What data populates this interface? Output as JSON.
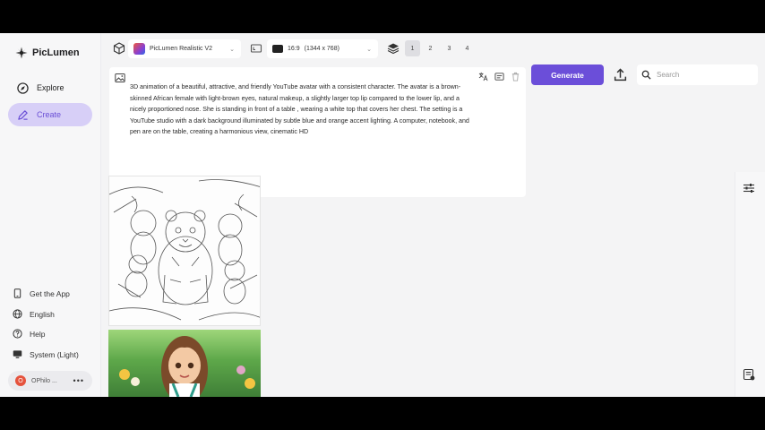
{
  "app": {
    "name": "PicLumen"
  },
  "nav": [
    {
      "label": "Explore",
      "icon": "compass-icon"
    },
    {
      "label": "Create",
      "icon": "pen-icon",
      "active": true
    }
  ],
  "bottom_nav": [
    {
      "label": "Get the App",
      "icon": "phone-icon"
    },
    {
      "label": "English",
      "icon": "globe-icon"
    },
    {
      "label": "Help",
      "icon": "help-icon"
    },
    {
      "label": "System (Light)",
      "icon": "monitor-icon"
    }
  ],
  "user": {
    "initial": "O",
    "name": "OPhilo ..."
  },
  "toolbar": {
    "model": "PicLumen Realistic V2",
    "ratio": "16:9",
    "resolution": "(1344 x 768)",
    "counts": [
      "1",
      "2",
      "3",
      "4"
    ],
    "selected_count": "1"
  },
  "prompt": {
    "text": "3D animation of a beautiful, attractive, and friendly YouTube avatar with a consistent character. The avatar is a brown-skinned African female with light-brown eyes, natural makeup, a slightly larger top lip compared to the lower lip, and a nicely proportioned nose. She is standing in front of a table , wearing a white top that covers her chest. The setting is a YouTube studio with a dark background illuminated by subtle blue and orange accent lighting. A computer, notebook, and pen are on the table, creating a harmonious view, cinematic HD"
  },
  "actions": {
    "generate": "Generate",
    "search_placeholder": "Search"
  },
  "colors": {
    "accent": "#6b4ed9",
    "active_nav_bg": "#d7cff7"
  }
}
